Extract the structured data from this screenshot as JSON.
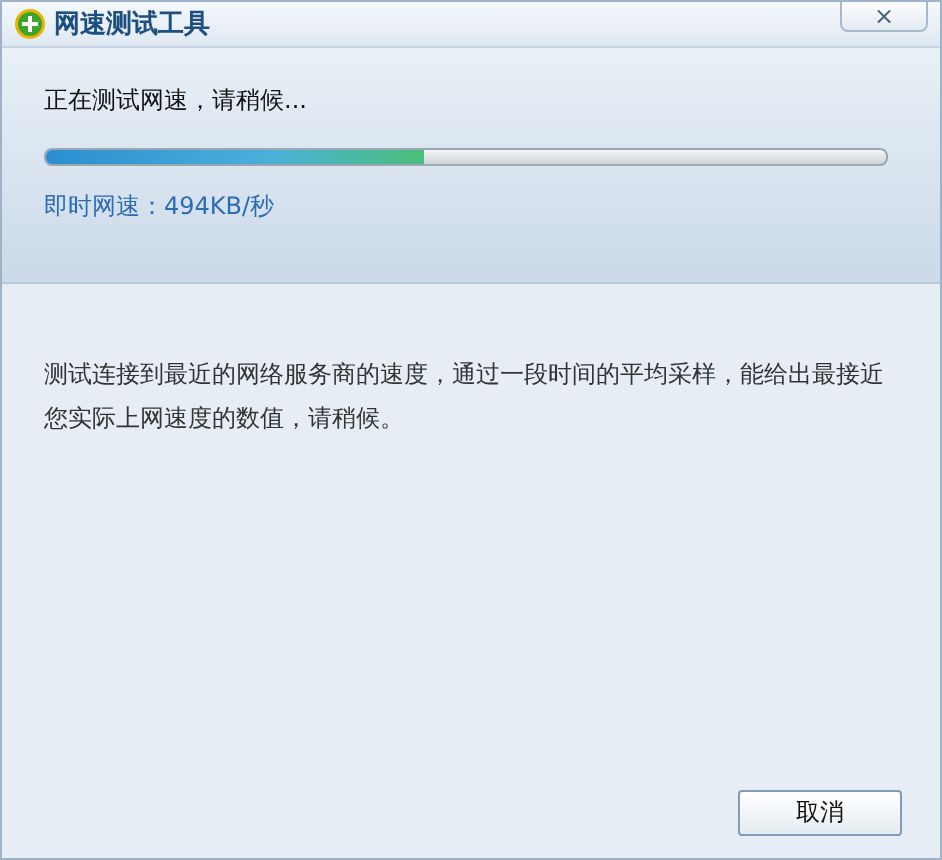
{
  "window": {
    "title": "网速测试工具",
    "close": "×"
  },
  "status": {
    "message": "正在测试网速，请稍候...",
    "level": 0.45,
    "speed_label": "即时网速：",
    "speed_value": "494KB/秒"
  },
  "description": "测试连接到最近的网络服务商的速度，通过一段时间的平均采样，能给出最接近您实际上网速度的数值，请稍候。",
  "buttons": [
    "取消"
  ]
}
